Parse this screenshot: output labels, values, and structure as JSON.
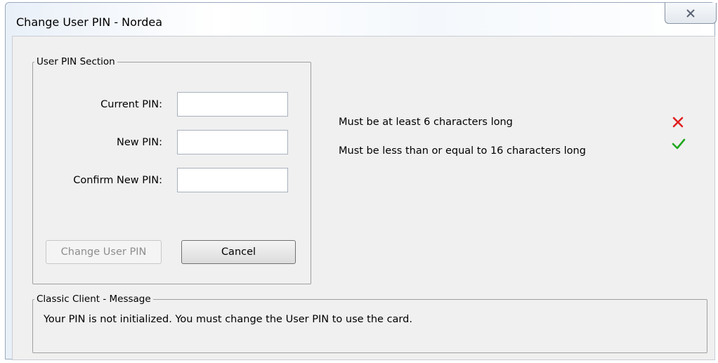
{
  "window": {
    "title": "Change User PIN - Nordea"
  },
  "pin_section": {
    "legend": "User PIN Section",
    "fields": [
      {
        "label": "Current PIN:",
        "value": ""
      },
      {
        "label": "New PIN:",
        "value": ""
      },
      {
        "label": "Confirm New PIN:",
        "value": ""
      }
    ],
    "change_button": "Change User PIN",
    "cancel_button": "Cancel"
  },
  "rules": [
    {
      "text": "Must be at least 6 characters long",
      "status": "fail",
      "icon": "cross-icon",
      "color": "#e02020"
    },
    {
      "text": "Must be less than or equal to 16 characters long",
      "status": "pass",
      "icon": "check-icon",
      "color": "#1fa81f"
    }
  ],
  "message_section": {
    "legend": "Classic Client - Message",
    "text": "Your PIN is not initialized. You must change the User PIN to use the card."
  }
}
